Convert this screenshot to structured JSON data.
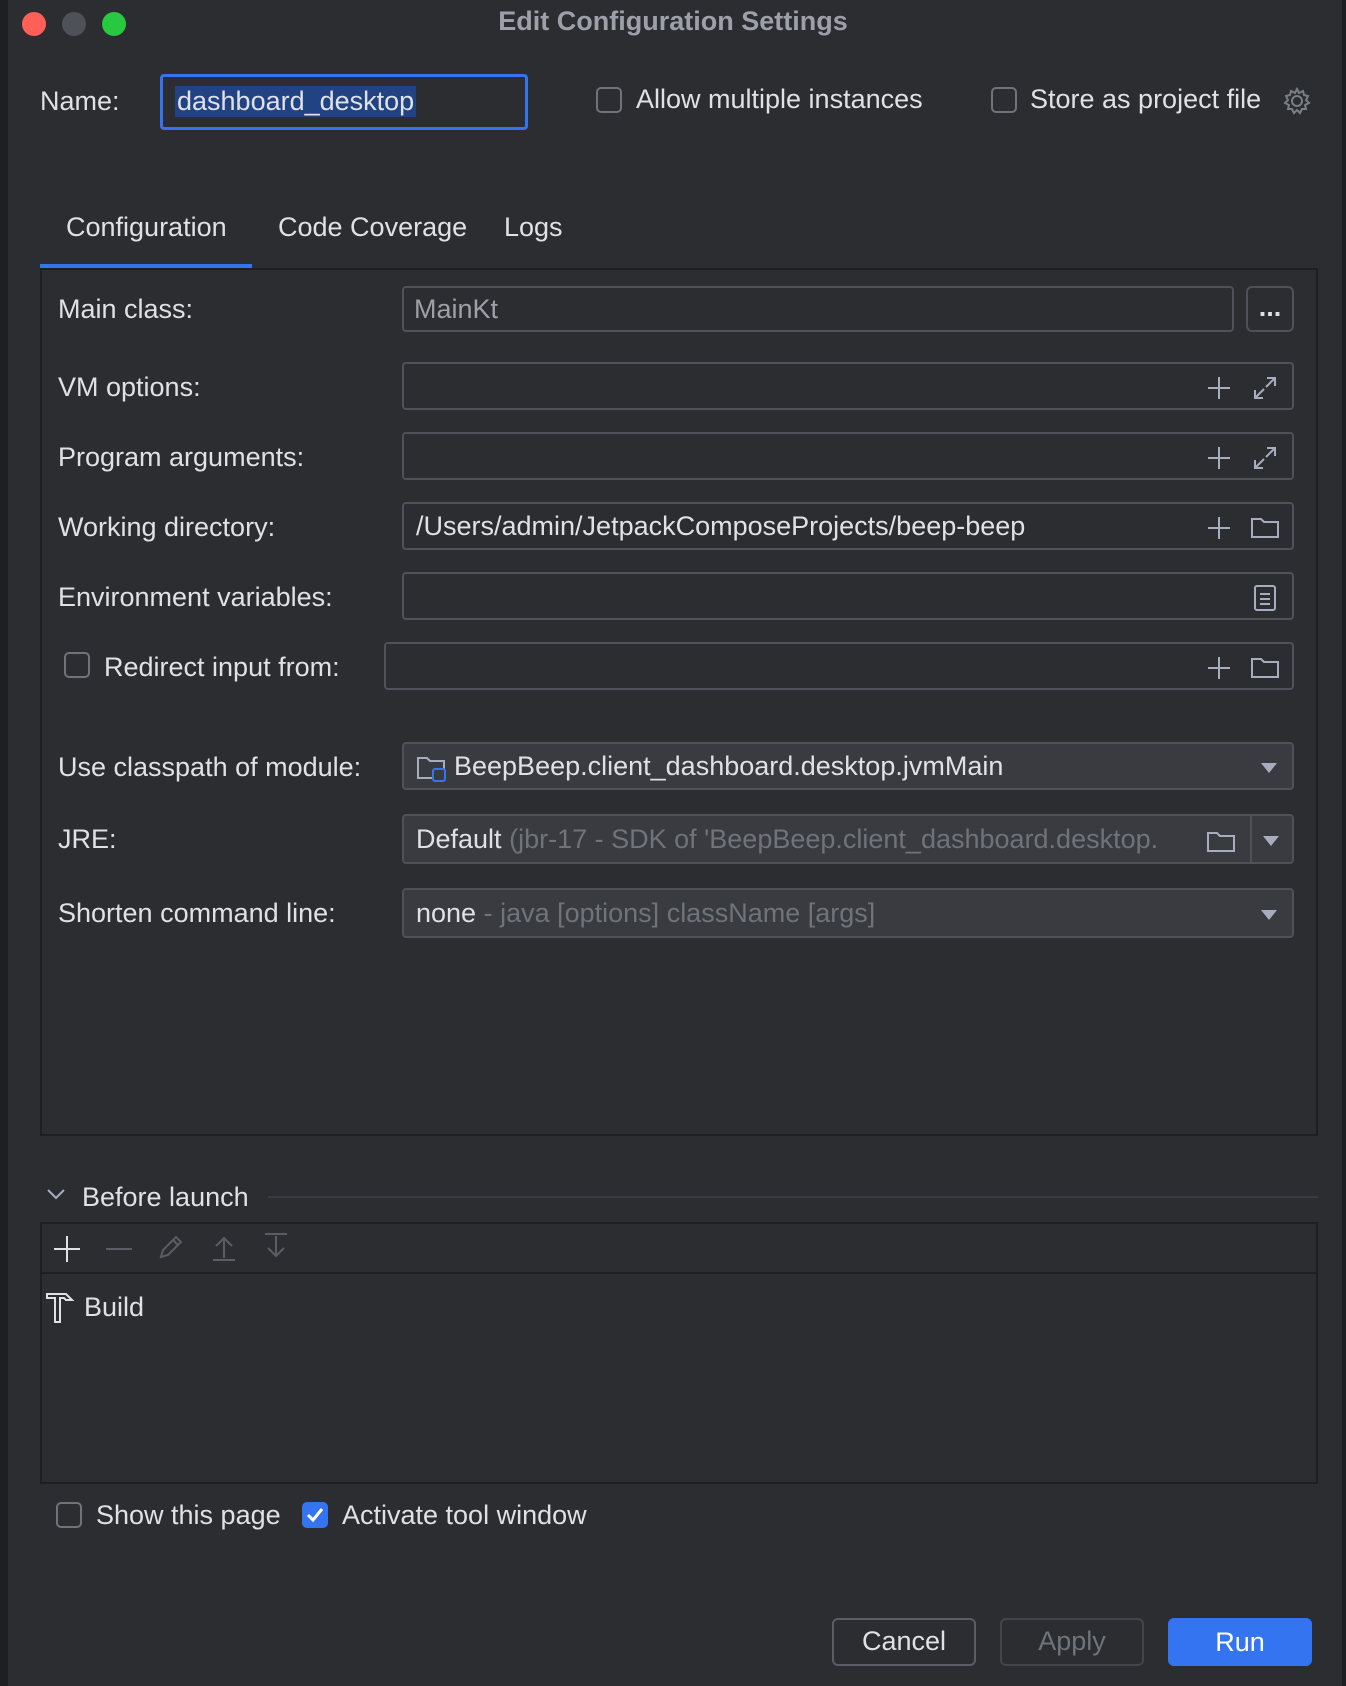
{
  "window": {
    "title": "Edit Configuration Settings"
  },
  "header": {
    "name_label": "Name:",
    "name_value": "dashboard_desktop",
    "allow_multiple_label": "Allow multiple instances",
    "store_project_label": "Store as project file"
  },
  "tabs": [
    {
      "label": "Configuration",
      "active": true
    },
    {
      "label": "Code Coverage"
    },
    {
      "label": "Logs"
    }
  ],
  "form": {
    "main_class_label": "Main class:",
    "main_class_value": "MainKt",
    "browse_label": "...",
    "vm_options_label": "VM options:",
    "program_args_label": "Program arguments:",
    "working_dir_label": "Working directory:",
    "working_dir_value": "/Users/admin/JetpackComposeProjects/beep-beep",
    "env_vars_label": "Environment variables:",
    "redirect_label": "Redirect input from:",
    "classpath_label": "Use classpath of module:",
    "classpath_value": "BeepBeep.client_dashboard.desktop.jvmMain",
    "jre_label": "JRE:",
    "jre_value": "Default",
    "jre_detail": "(jbr-17 - SDK of 'BeepBeep.client_dashboard.desktop.",
    "shorten_label": "Shorten command line:",
    "shorten_value": "none",
    "shorten_detail": "- java [options] className [args]"
  },
  "before_launch": {
    "title": "Before launch",
    "items": [
      {
        "label": "Build"
      }
    ]
  },
  "footer": {
    "show_page_label": "Show this page",
    "activate_label": "Activate tool window",
    "cancel": "Cancel",
    "apply": "Apply",
    "run": "Run"
  },
  "colors": {
    "accent": "#3574f0",
    "background": "#2b2d30",
    "border": "#4e5157"
  }
}
